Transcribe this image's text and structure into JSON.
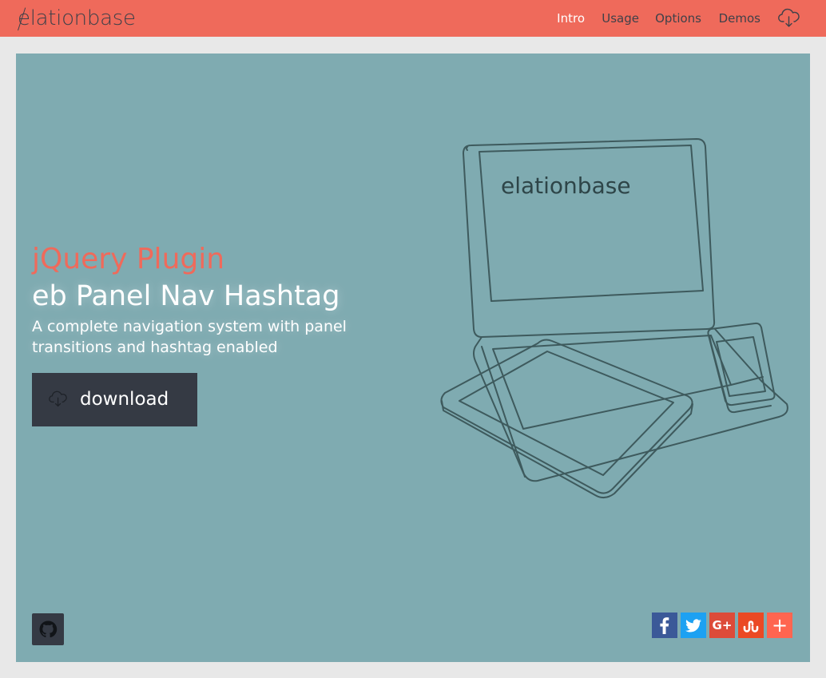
{
  "brand": {
    "name": "elationbase",
    "first_letter": "e",
    "rest": "lationbase"
  },
  "nav": {
    "items": [
      {
        "label": "Intro",
        "active": true
      },
      {
        "label": "Usage",
        "active": false
      },
      {
        "label": "Options",
        "active": false
      },
      {
        "label": "Demos",
        "active": false
      }
    ],
    "download_icon": "cloud-download-icon"
  },
  "hero": {
    "kicker": "jQuery Plugin",
    "title": "eb Panel Nav Hashtag",
    "tagline": "A complete navigation system with panel transitions and hashtag enabled",
    "download_label": "download",
    "download_icon": "cloud-download-icon",
    "illustration_icon": "devices-illustration",
    "screen_logo": "elationbase"
  },
  "footer": {
    "github_icon": "github-icon",
    "share": [
      {
        "name": "facebook",
        "glyph": "f",
        "color": "#3b5998"
      },
      {
        "name": "twitter",
        "glyph": "t",
        "color": "#1da1f2"
      },
      {
        "name": "google-plus",
        "glyph": "G+",
        "color": "#dd4b39"
      },
      {
        "name": "stumbleupon",
        "glyph": "su",
        "color": "#eb4924"
      },
      {
        "name": "more",
        "glyph": "+",
        "color": "#ff6550"
      }
    ]
  },
  "colors": {
    "accent": "#ef6a5b",
    "hero_bg": "#7fabb1",
    "dark": "#353a44",
    "text_dark": "#3f4149"
  }
}
